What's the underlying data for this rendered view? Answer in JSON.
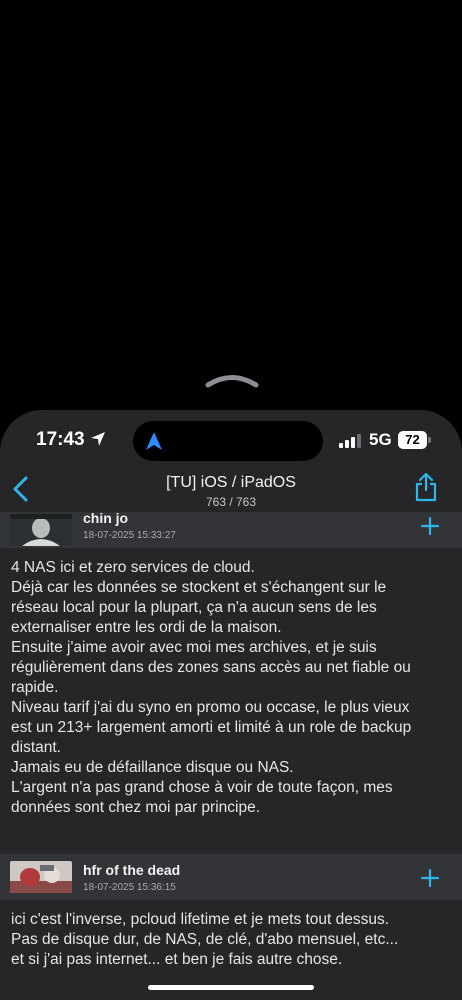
{
  "status_bar": {
    "time": "17:43",
    "network": "5G",
    "battery": "72"
  },
  "nav": {
    "title": "[TU] iOS / iPadOS",
    "subtitle": "763 / 763"
  },
  "posts": [
    {
      "author": "chin jo",
      "date": "18-07-2025 15:33:27",
      "lines": [
        "4 NAS ici et zero services de cloud.",
        "Déjà car les données se stockent et s'échangent sur le",
        "réseau local pour la plupart, ça n'a aucun sens de les",
        "externaliser entre les ordi de la maison.",
        "Ensuite j'aime avoir avec moi mes archives, et je suis",
        "régulièrement dans des zones sans accès au net fiable ou",
        "rapide.",
        "Niveau tarif j'ai du syno en promo ou occase, le plus vieux",
        "est un 213+ largement amorti et limité à un role de backup",
        "distant.",
        "Jamais eu de défaillance disque ou NAS.",
        "L'argent n'a pas grand chose à voir de toute façon, mes",
        "données sont chez moi par principe."
      ]
    },
    {
      "author": "hfr of the dead",
      "date": "18-07-2025 15:36:15",
      "lines": [
        "ici c'est l'inverse, pcloud lifetime et je mets tout dessus.",
        "Pas de disque dur, de NAS, de clé, d'abo mensuel, etc...",
        "et si j'ai pas internet... et ben je fais autre chose."
      ]
    }
  ],
  "colors": {
    "accent": "#2fb6e8",
    "background": "#262629",
    "post_header": "#333437"
  },
  "icons": {
    "back": "chevron-left-icon",
    "share": "share-icon",
    "quote": "plus-icon"
  }
}
